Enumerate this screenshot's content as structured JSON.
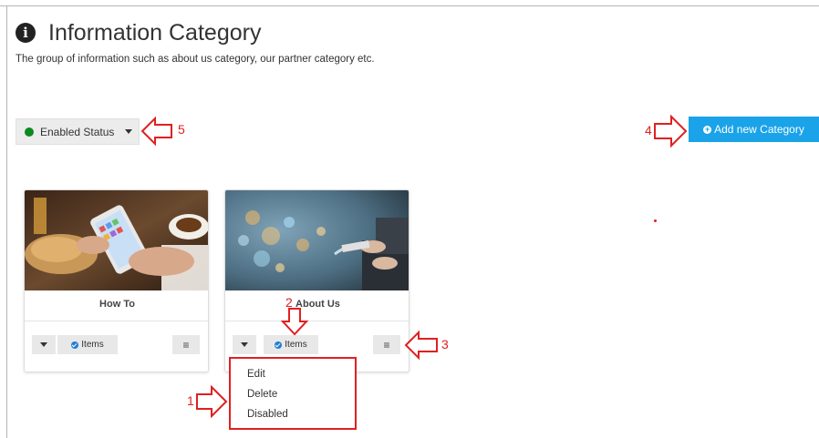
{
  "header": {
    "title": "Information Category",
    "subtitle": "The group of information such as about us category, our partner category etc."
  },
  "toolbar": {
    "status_label": "Enabled Status",
    "add_label": "Add new Category"
  },
  "cards": [
    {
      "name": "How To",
      "items_label": "Items"
    },
    {
      "name": "About Us",
      "items_label": "Items"
    }
  ],
  "menu": {
    "items": [
      "Edit",
      "Delete",
      "Disabled"
    ]
  },
  "annotations": [
    "1",
    "2",
    "3",
    "4",
    "5"
  ],
  "colors": {
    "accent": "#1aa3e8",
    "status_green": "#0a8a1f",
    "annotation_red": "#e02020",
    "items_icon": "#1e7fd6"
  }
}
